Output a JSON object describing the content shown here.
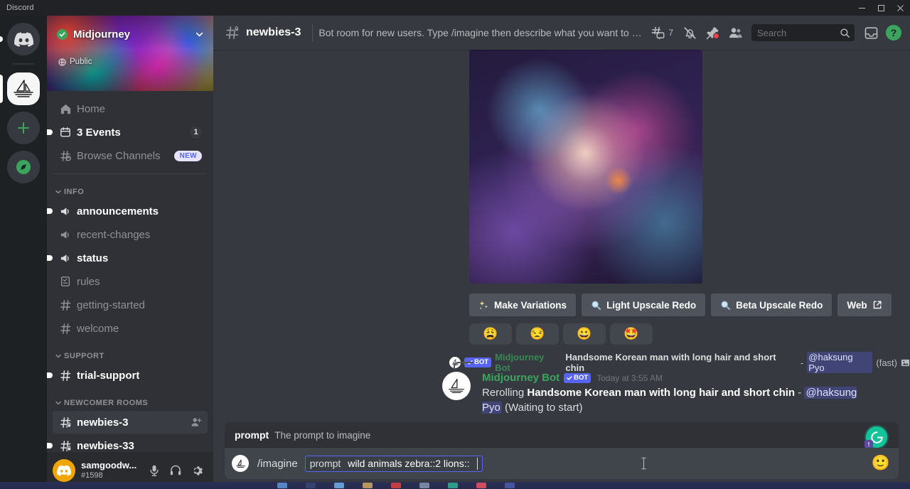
{
  "window": {
    "title": "Discord",
    "controls": {
      "minimize": "minimize-icon",
      "maximize": "maximize-icon",
      "close": "close-icon"
    }
  },
  "server_rail": {
    "servers": [
      {
        "name": "Discord Home",
        "icon": "discord-logo-icon",
        "state": "unread"
      },
      {
        "name": "Midjourney",
        "icon": "midjourney-sailboat-icon",
        "state": "active"
      },
      {
        "name": "Add a Server",
        "icon": "plus-icon",
        "state": "none"
      },
      {
        "name": "Explore Public Servers",
        "icon": "compass-icon",
        "state": "none"
      }
    ]
  },
  "sidebar": {
    "guild": {
      "name": "Midjourney",
      "verified": true,
      "privacy_label": "Public",
      "privacy_icon": "globe-icon",
      "chevron_icon": "chevron-down-icon"
    },
    "nav": [
      {
        "label": "Home",
        "icon": "home-icon",
        "state": "normal",
        "badge": null
      },
      {
        "label": "3 Events",
        "icon": "calendar-icon",
        "state": "unread",
        "badge": "1"
      },
      {
        "label": "Browse Channels",
        "icon": "hash-search-icon",
        "state": "normal",
        "badge": "NEW"
      }
    ],
    "categories": [
      {
        "name": "INFO",
        "channels": [
          {
            "label": "announcements",
            "icon": "announcement-icon",
            "state": "unread"
          },
          {
            "label": "recent-changes",
            "icon": "announcement-icon",
            "state": "normal"
          },
          {
            "label": "status",
            "icon": "announcement-icon",
            "state": "unread"
          },
          {
            "label": "rules",
            "icon": "rules-icon",
            "state": "normal"
          },
          {
            "label": "getting-started",
            "icon": "hash-icon",
            "state": "normal"
          },
          {
            "label": "welcome",
            "icon": "hash-icon",
            "state": "normal"
          }
        ]
      },
      {
        "name": "SUPPORT",
        "channels": [
          {
            "label": "trial-support",
            "icon": "hash-icon",
            "state": "unread"
          }
        ]
      },
      {
        "name": "NEWCOMER ROOMS",
        "channels": [
          {
            "label": "newbies-3",
            "icon": "hash-restricted-icon",
            "state": "selected",
            "action_icon": "add-member-icon"
          },
          {
            "label": "newbies-33",
            "icon": "hash-restricted-icon",
            "state": "unread"
          }
        ]
      }
    ],
    "user_panel": {
      "username": "samgoodw...",
      "discriminator": "#1598",
      "avatar_icon": "discord-avatar-icon",
      "buttons": [
        {
          "name": "mute-button",
          "icon": "microphone-icon"
        },
        {
          "name": "deafen-button",
          "icon": "headphones-icon"
        },
        {
          "name": "user-settings-button",
          "icon": "gear-icon"
        }
      ]
    }
  },
  "channel_header": {
    "hash_icon": "hash-restricted-icon",
    "channel_name": "newbies-3",
    "topic": "Bot room for new users. Type /imagine then describe what you want to draw. S...",
    "tools": [
      {
        "name": "threads-button",
        "icon": "threads-icon",
        "count": "7"
      },
      {
        "name": "notification-settings-button",
        "icon": "bell-slash-icon"
      },
      {
        "name": "pinned-messages-button",
        "icon": "pin-icon",
        "has_dot": true
      },
      {
        "name": "member-list-button",
        "icon": "members-icon"
      }
    ],
    "search": {
      "placeholder": "Search",
      "value": "",
      "icon": "search-icon"
    },
    "inbox": {
      "name": "inbox-button",
      "icon": "inbox-icon"
    },
    "help": {
      "name": "help-button",
      "icon": "help-icon",
      "glyph": "?",
      "color": "#3ba55d"
    }
  },
  "messages": {
    "image_message": {
      "image_alt": "midjourney-generated-cosmic-portrait",
      "buttons": [
        {
          "label": "Make Variations",
          "icon": "sparkles-icon"
        },
        {
          "label": "Light Upscale Redo",
          "icon": "magnifier-icon"
        },
        {
          "label": "Beta Upscale Redo",
          "icon": "magnifier-icon"
        },
        {
          "label": "Web",
          "icon": "external-link-icon"
        }
      ],
      "reactions": [
        {
          "emoji": "😩",
          "name": "weary-face-reaction"
        },
        {
          "emoji": "😒",
          "name": "unamused-face-reaction"
        },
        {
          "emoji": "😀",
          "name": "grinning-face-reaction"
        },
        {
          "emoji": "🤩",
          "name": "star-struck-reaction"
        }
      ]
    },
    "reply_reference": {
      "bot_label": "BOT",
      "author": "Midjourney Bot",
      "prompt_text": "Handsome Korean man with long hair and short chin",
      "separator": "-",
      "mention": "@haksung Pyo",
      "suffix": "(fast)",
      "attachment_icon": "image-attachment-icon"
    },
    "bot_message": {
      "author": "Midjourney Bot",
      "bot_label": "BOT",
      "timestamp": "Today at 3:55 AM",
      "prefix": "Rerolling ",
      "prompt_text": "Handsome Korean man with long hair and short chin",
      "separator": " - ",
      "mention": "@haksung Pyo",
      "status": " (Waiting to start)"
    }
  },
  "composer": {
    "autocomplete": {
      "key": "prompt",
      "description": "The prompt to imagine"
    },
    "grammarly": {
      "name": "grammarly-button",
      "glyph": "G",
      "color": "#15c39a",
      "badge": "!"
    },
    "command": {
      "avatar_icon": "midjourney-sailboat-icon",
      "command_name": "/imagine",
      "option_key": "prompt",
      "option_value": "wild animals zebra::2 lions::"
    },
    "emoji_button": {
      "name": "emoji-picker-button",
      "glyph": "🙂"
    }
  },
  "taskbar": {
    "items": [
      {
        "name": "taskbar-item-1",
        "color": "#5b8fd0"
      },
      {
        "name": "taskbar-item-2",
        "color": "#3a4470"
      },
      {
        "name": "taskbar-item-3",
        "color": "#6aa8e0"
      },
      {
        "name": "taskbar-item-4",
        "color": "#c8a060"
      },
      {
        "name": "taskbar-item-5",
        "color": "#d04040"
      },
      {
        "name": "taskbar-item-6",
        "color": "#8090a8"
      },
      {
        "name": "taskbar-item-7",
        "color": "#30a890"
      },
      {
        "name": "taskbar-item-8",
        "color": "#e05060"
      },
      {
        "name": "taskbar-item-9",
        "color": "#4a5aa8"
      }
    ]
  }
}
